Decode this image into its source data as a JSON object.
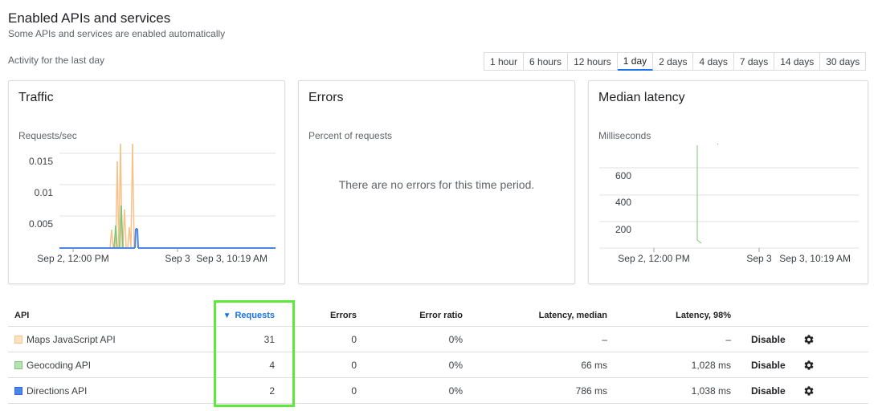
{
  "header": {
    "title": "Enabled APIs and services",
    "subtitle": "Some APIs and services are enabled automatically",
    "activity_label": "Activity for the last day"
  },
  "time_ranges": [
    "1 hour",
    "6 hours",
    "12 hours",
    "1 day",
    "2 days",
    "4 days",
    "7 days",
    "14 days",
    "30 days"
  ],
  "active_range": "1 day",
  "cards": {
    "traffic": {
      "title": "Traffic",
      "unit": "Requests/sec"
    },
    "errors": {
      "title": "Errors",
      "unit": "Percent of requests",
      "empty_message": "There are no errors for this time period."
    },
    "latency": {
      "title": "Median latency",
      "unit": "Milliseconds"
    }
  },
  "chart_data": [
    {
      "type": "bar",
      "title": "Traffic",
      "ylabel": "Requests/sec",
      "ylim": [
        0,
        0.02
      ],
      "yticks": [
        "0.015",
        "0.01",
        "0.005"
      ],
      "xticks": [
        "Sep 2, 12:00 PM",
        "Sep 3",
        "Sep 3, 10:19 AM"
      ]
    },
    {
      "type": "line",
      "title": "Errors",
      "ylabel": "Percent of requests",
      "xticks": []
    },
    {
      "type": "line",
      "title": "Median latency",
      "ylabel": "Milliseconds",
      "ylim": [
        0,
        800
      ],
      "yticks": [
        "600",
        "400",
        "200"
      ],
      "xticks": [
        "Sep 2, 12:00 PM",
        "Sep 3",
        "Sep 3, 10:19 AM"
      ]
    }
  ],
  "table": {
    "columns": {
      "api": "API",
      "requests": "Requests",
      "errors": "Errors",
      "error_ratio": "Error ratio",
      "latency_median": "Latency, median",
      "latency_98": "Latency, 98%"
    },
    "disable_label": "Disable",
    "rows": [
      {
        "api": "Maps JavaScript API",
        "color": "#f6c289",
        "requests": "31",
        "errors": "0",
        "error_ratio": "0%",
        "latency_median": "–",
        "latency_98": "–"
      },
      {
        "api": "Geocoding API",
        "color": "#7cc576",
        "requests": "4",
        "errors": "0",
        "error_ratio": "0%",
        "latency_median": "66 ms",
        "latency_98": "1,028 ms"
      },
      {
        "api": "Directions API",
        "color": "#4a86e8",
        "requests": "2",
        "errors": "0",
        "error_ratio": "0%",
        "latency_median": "786 ms",
        "latency_98": "1,038 ms"
      }
    ]
  },
  "colors": {
    "accent": "#1a73e8",
    "highlight": "#5ee83a",
    "border": "#dadce0"
  }
}
